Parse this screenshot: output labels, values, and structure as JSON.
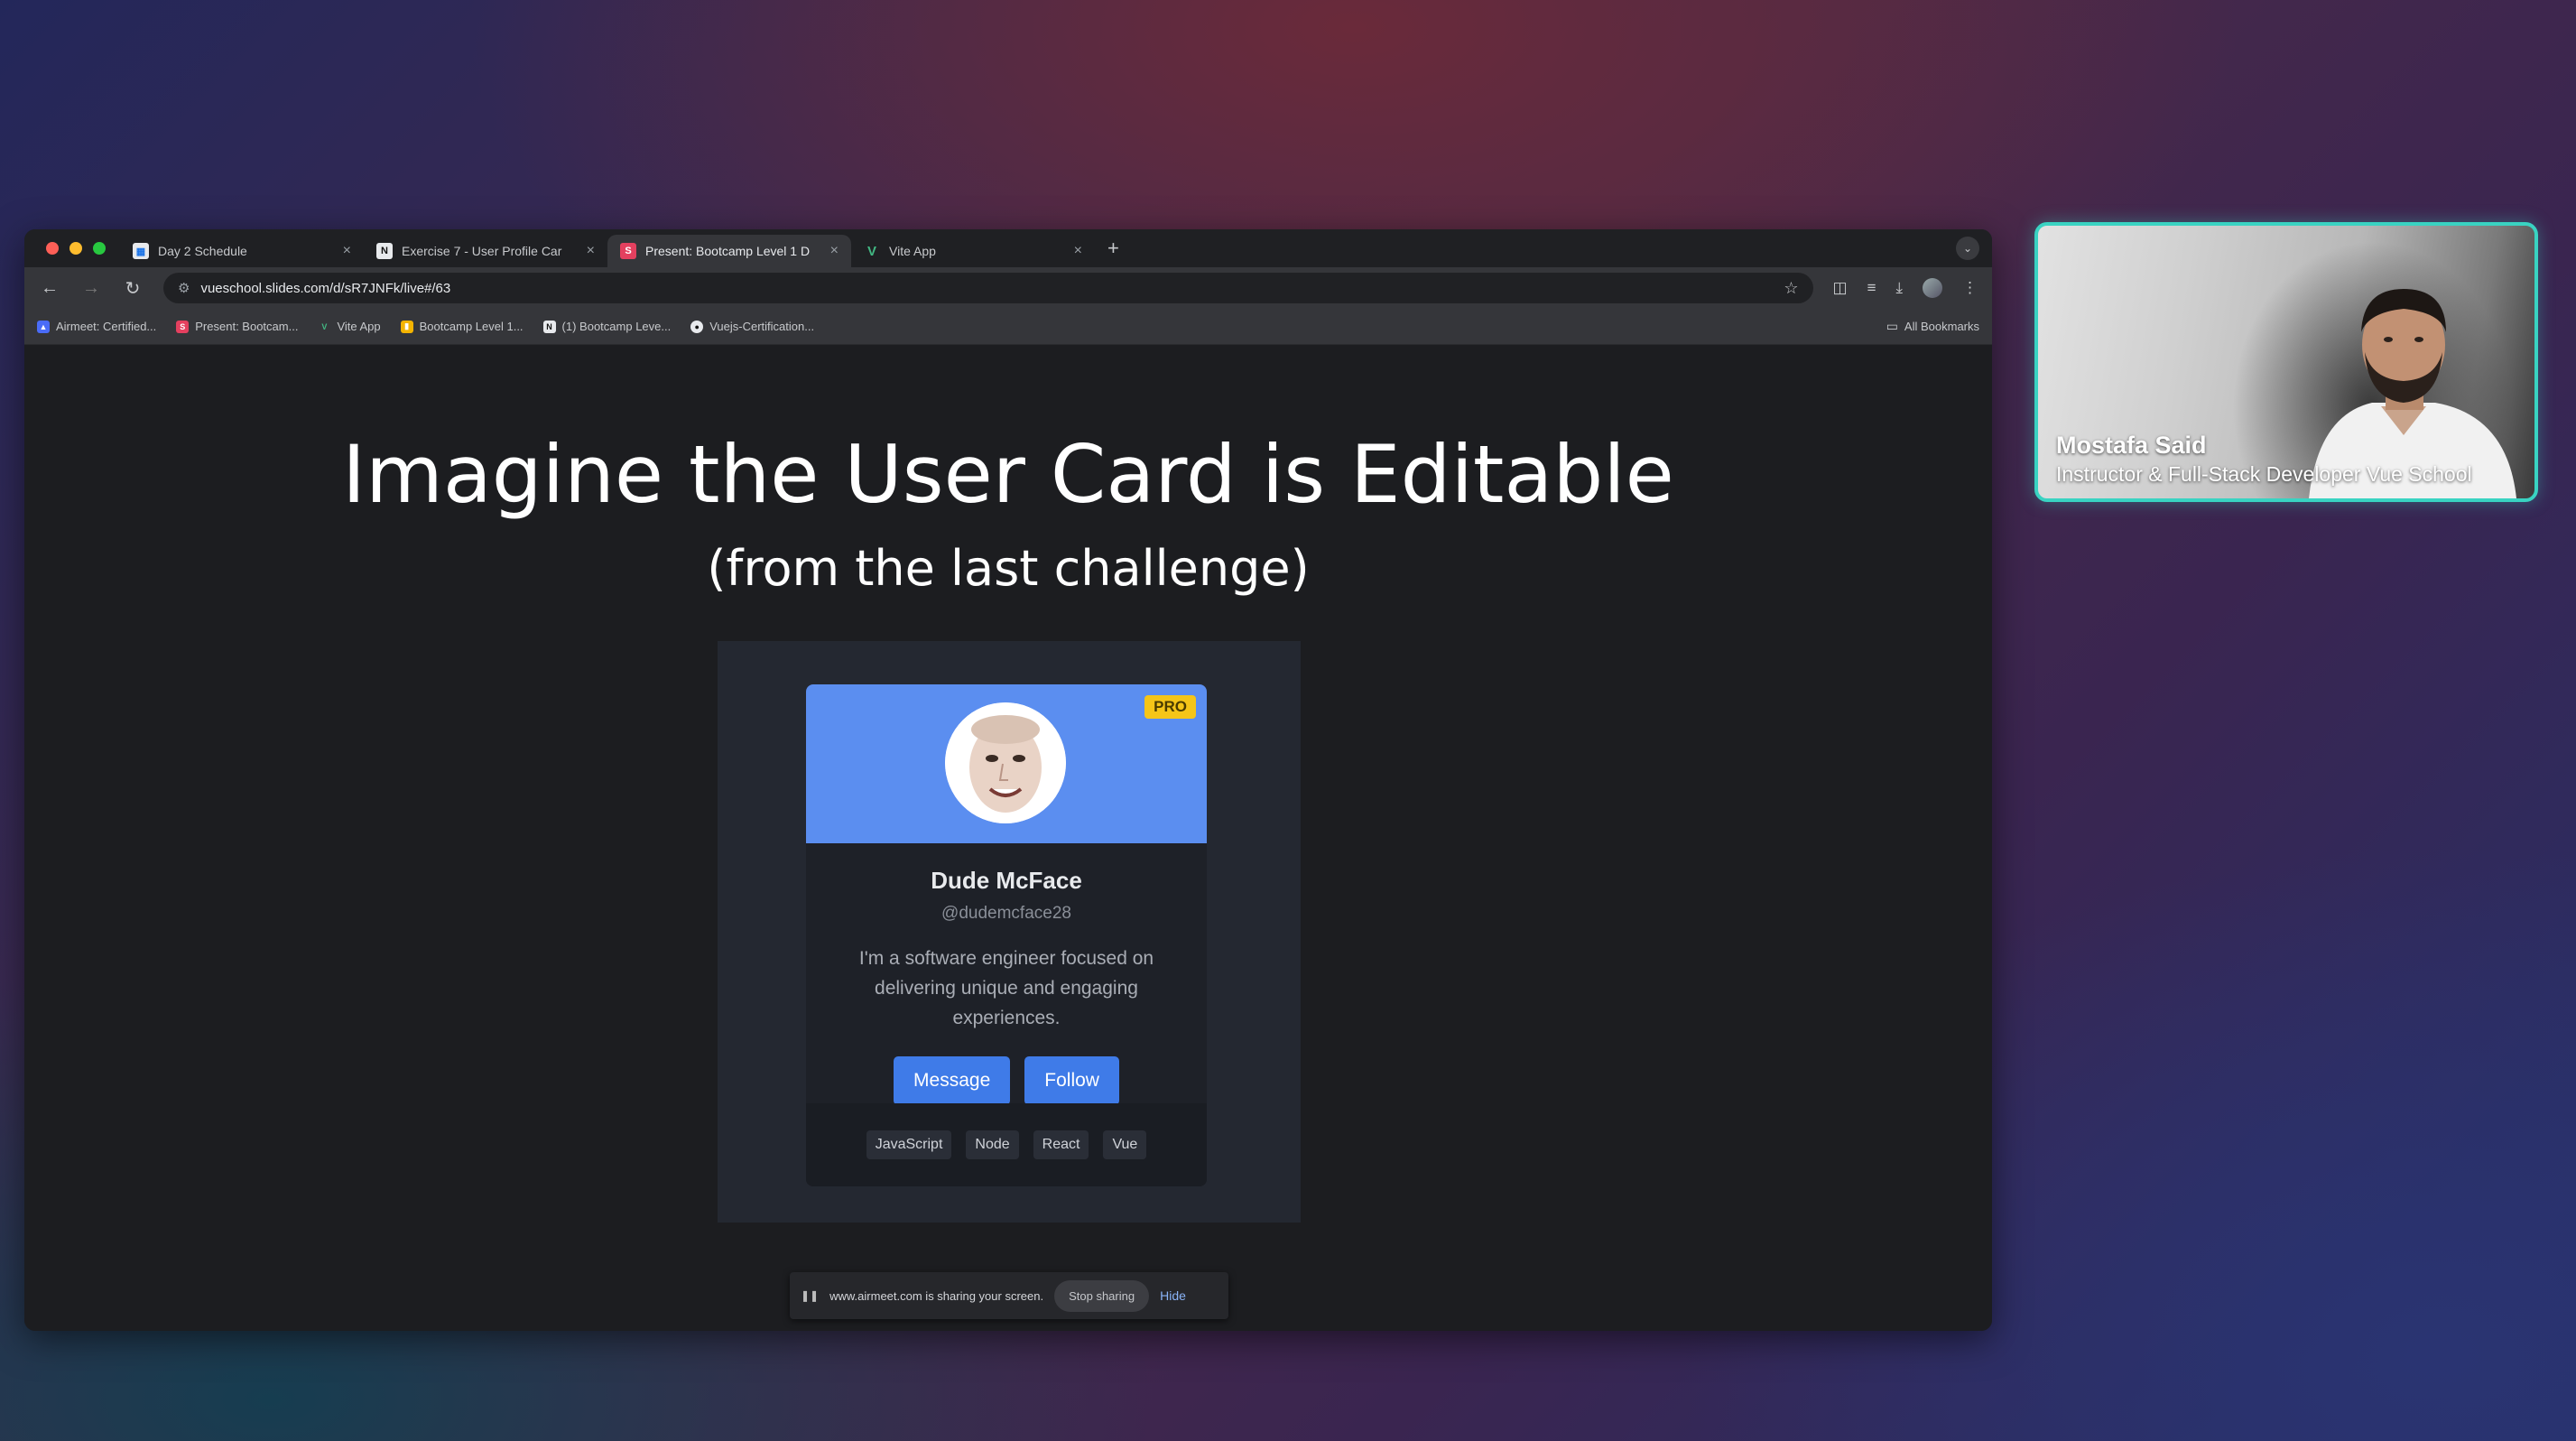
{
  "browser": {
    "tabs": [
      {
        "title": "Day 2 Schedule",
        "favicon": "calendar-icon",
        "active": false
      },
      {
        "title": "Exercise 7 - User Profile Car",
        "favicon": "notion-icon",
        "active": false
      },
      {
        "title": "Present: Bootcamp Level 1 D",
        "favicon": "slides-icon",
        "active": true
      },
      {
        "title": "Vite App",
        "favicon": "vue-icon",
        "active": false
      }
    ],
    "url": "vueschool.slides.com/d/sR7JNFk/live#/63",
    "bookmarks": [
      {
        "label": "Airmeet: Certified..."
      },
      {
        "label": "Present: Bootcam..."
      },
      {
        "label": "Vite App"
      },
      {
        "label": "Bootcamp Level 1..."
      },
      {
        "label": "(1) Bootcamp Leve..."
      },
      {
        "label": "Vuejs-Certification..."
      }
    ],
    "all_bookmarks": "All Bookmarks"
  },
  "slide": {
    "title": "Imagine the User Card is Editable",
    "subtitle": "(from the last challenge)"
  },
  "card": {
    "badge": "PRO",
    "name": "Dude McFace",
    "handle": "@dudemcface28",
    "bio": "I'm a software engineer focused on delivering unique and engaging experiences.",
    "message_label": "Message",
    "follow_label": "Follow",
    "tags": [
      "JavaScript",
      "Node",
      "React",
      "Vue"
    ],
    "header_color": "#5b8ef0",
    "button_color": "#3f7be8"
  },
  "sharing": {
    "text": "www.airmeet.com is sharing your screen.",
    "stop_label": "Stop sharing",
    "hide_label": "Hide"
  },
  "presenter": {
    "name": "Mostafa Said",
    "role": "Instructor & Full-Stack Developer Vue School",
    "border_color": "#39d3c2"
  }
}
